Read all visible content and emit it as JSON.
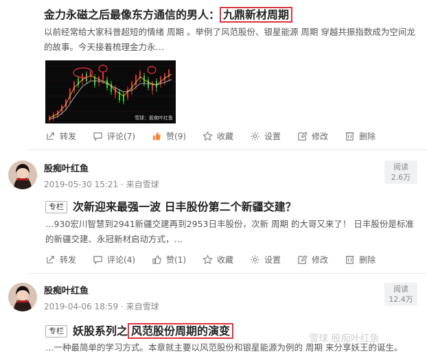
{
  "posts": [
    {
      "title_main": "金力永磁之后最像东方通信的男人：",
      "title_highlight": "九鼎新材周期",
      "excerpt": "以前经常给大家科普超短的情绪 周期 。举例了风范股份、银星能源 周期 穿越共振指数成为空间龙的故事。今天接着梳理金力永…",
      "chart_caption": "雪球：股痴叶红鱼",
      "actions": {
        "repost": "转发",
        "comment": "评论(7)",
        "like": "赞(9)",
        "favorite": "收藏",
        "settings": "设置",
        "edit": "修改",
        "delete": "删除"
      }
    },
    {
      "author": "股痴叶红鱼",
      "date": "2019-05-30 15:21",
      "source": "· 来自雪球",
      "reads_label": "阅读",
      "reads_value": "2.6万",
      "tag": "专栏",
      "title": "次新迎来最强一波 日丰股份第二个新疆交建？",
      "excerpt": "…930宏川智慧到2941新疆交建再到2953日丰股份，次新 周期 的大哥又来了！ 日丰股份是标准的新疆交建、永冠新材启动方式，…",
      "actions": {
        "repost": "转发",
        "comment": "评论(4)",
        "like": "赞(1)",
        "favorite": "收藏",
        "settings": "设置",
        "edit": "修改",
        "delete": "删除"
      }
    },
    {
      "author": "股痴叶红鱼",
      "date": "2019-04-06 18:59",
      "source": "· 来自雪球",
      "reads_label": "阅读",
      "reads_value": "12.4万",
      "tag": "专栏",
      "title_main": "妖股系列之",
      "title_highlight": "风范股份周期的演变",
      "excerpt": "…一种最简单的学习方式。本章就主要以风范股份和银星能源为例的 周期 来分享妖王的诞生。"
    }
  ],
  "watermark": "雪球  股痴叶红鱼",
  "colors": {
    "highlight_border": "#e0303a",
    "like_active": "#f0883a",
    "reads_bg": "#f0f1f3"
  }
}
